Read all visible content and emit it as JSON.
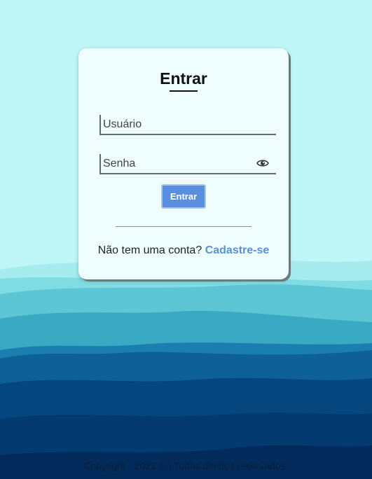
{
  "login": {
    "title": "Entrar",
    "username_placeholder": "Usuário",
    "password_placeholder": "Senha",
    "submit_label": "Entrar",
    "signup_prompt": "Não tem uma conta?",
    "signup_link": "Cadastre-se",
    "password_toggle_icon": "eye-icon"
  },
  "footer": {
    "text": "Copyright - 2021 © | Todos direitos reservados."
  },
  "colors": {
    "sky": "#bff6f7",
    "card": "#effdfe",
    "accent": "#5a8fdf",
    "link": "#5a8fd6"
  }
}
